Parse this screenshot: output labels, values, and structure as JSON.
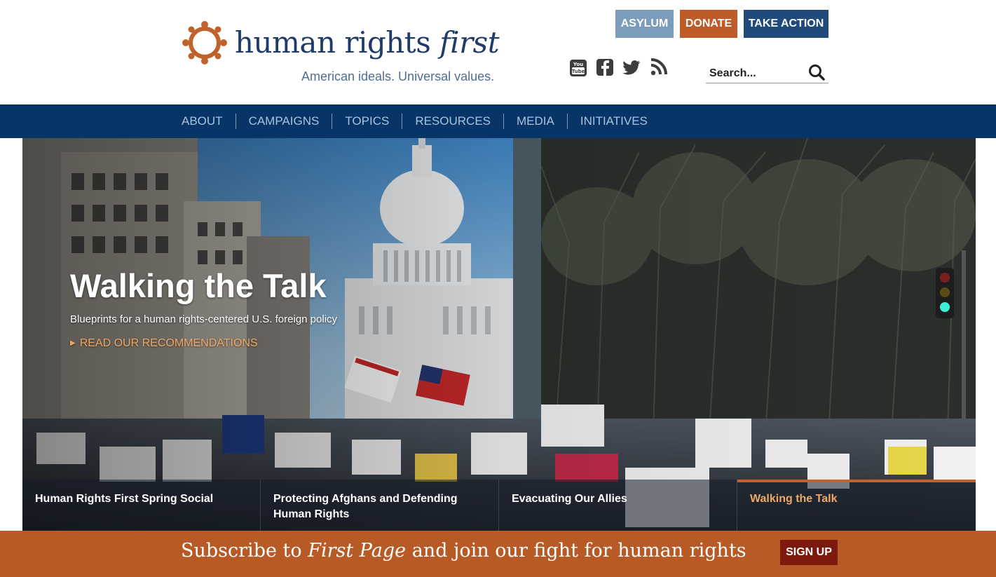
{
  "header": {
    "logo_text_main": "human rights ",
    "logo_text_em": "first",
    "tagline": "American ideals. Universal values.",
    "buttons": {
      "asylum": "ASYLUM",
      "donate": "DONATE",
      "take_action": "TAKE ACTION"
    },
    "social": [
      "youtube-icon",
      "facebook-icon",
      "twitter-icon",
      "rss-icon"
    ],
    "search": {
      "placeholder": "Search...",
      "value": ""
    }
  },
  "nav": {
    "items": [
      "ABOUT",
      "CAMPAIGNS",
      "TOPICS",
      "RESOURCES",
      "MEDIA",
      "INITIATIVES"
    ]
  },
  "hero": {
    "title": "Walking the Talk",
    "subtitle": "Blueprints for a human rights-centered U.S. foreign policy",
    "link": "READ OUR RECOMMENDATIONS",
    "slides": [
      {
        "label": "Human Rights First Spring Social",
        "active": false
      },
      {
        "label": "Protecting Afghans and Defending Human Rights",
        "active": false
      },
      {
        "label": "Evacuating Our Allies",
        "active": false
      },
      {
        "label": "Walking the Talk",
        "active": true
      }
    ]
  },
  "subscribe": {
    "text_before": "Subscribe to ",
    "text_em": "First Page",
    "text_after": " and join our fight for human rights",
    "button": "SIGN UP"
  },
  "colors": {
    "brand_blue": "#1e3c6b",
    "nav_bg": "#073568",
    "orange": "#bf5b28",
    "subscribe_bg": "#b85a25",
    "signup_bg": "#7d1a0e",
    "asylum_bg": "#7b9cba",
    "action_bg": "#1f4a7b",
    "link_orange": "#f0a862"
  }
}
